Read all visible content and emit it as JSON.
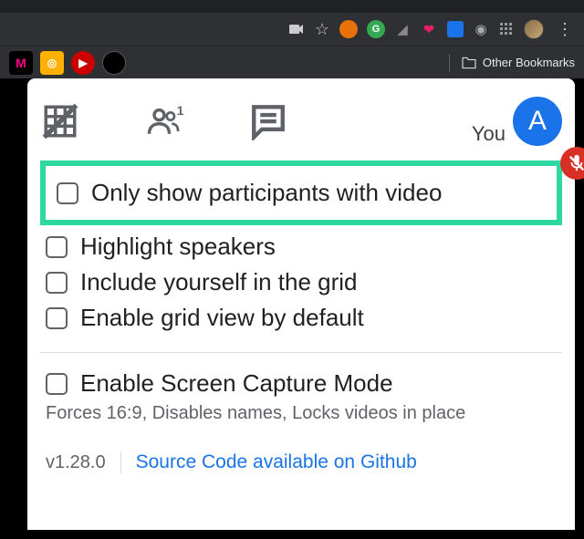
{
  "bookmarks_bar": {
    "other_label": "Other Bookmarks"
  },
  "panel": {
    "you_label": "You",
    "you_initial": "A"
  },
  "options": [
    {
      "label": "Only show participants with video",
      "checked": false,
      "highlighted": true
    },
    {
      "label": "Highlight speakers",
      "checked": false
    },
    {
      "label": "Include yourself in the grid",
      "checked": false
    },
    {
      "label": "Enable grid view by default",
      "checked": false
    }
  ],
  "screen_capture": {
    "label": "Enable Screen Capture Mode",
    "subtext": "Forces 16:9, Disables names, Locks videos in place",
    "checked": false
  },
  "footer": {
    "version": "v1.28.0",
    "link_text": "Source Code available on Github"
  }
}
